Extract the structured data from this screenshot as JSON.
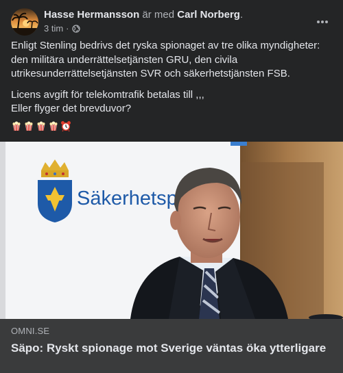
{
  "post": {
    "author": "Hasse Hermansson",
    "with_text": "är med",
    "tagged": "Carl Norberg",
    "period": ".",
    "time": "3 tim",
    "separator": "·",
    "privacy_icon": "globe-icon",
    "more_icon": "more-options-icon"
  },
  "body": {
    "paragraph1": "Enligt Stenling bedrivs det ryska spionaget av tre olika myndigheter: den militära underrättelsetjänsten GRU, den civila utrikesunderrättelsetjänsten SVR och säkerhetstjänsten FSB.",
    "paragraph2_line1": "Licens avgift för telekomtrafik betalas till ,,,",
    "paragraph2_line2": "Eller flyger det brevduvor?",
    "emojis": [
      "popcorn-icon",
      "popcorn-icon",
      "popcorn-icon",
      "popcorn-icon",
      "alarm-clock-icon"
    ]
  },
  "link_preview": {
    "image_sign_text": "Säkerhetspo",
    "domain": "OMNI.SE",
    "title": "Säpo: Ryskt spionage mot Sverige väntas öka ytterligare"
  },
  "colors": {
    "background": "#242526",
    "link_footer": "#3a3b3c",
    "primary_text": "#e4e6eb",
    "secondary_text": "#b0b3b8",
    "sign_blue": "#1e5aa8"
  }
}
